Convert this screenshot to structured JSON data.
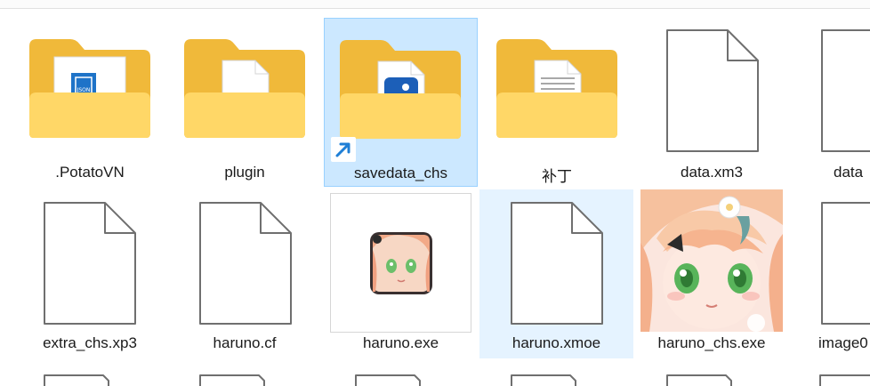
{
  "items": [
    {
      "label": ".PotatoVN",
      "icon": "folder-json-icon"
    },
    {
      "label": "plugin",
      "icon": "folder-file-icon"
    },
    {
      "label": "savedata_chs",
      "icon": "folder-shortcut-icon",
      "selected": true
    },
    {
      "label": "补丁",
      "icon": "folder-doc-icon"
    },
    {
      "label": "data.xm3",
      "icon": "blank-file-icon"
    },
    {
      "label": "data",
      "icon": "blank-file-icon"
    },
    {
      "label": "extra_chs.xp3",
      "icon": "blank-file-icon"
    },
    {
      "label": "haruno.cf",
      "icon": "blank-file-icon"
    },
    {
      "label": "haruno.exe",
      "icon": "exe-thumbnail-icon"
    },
    {
      "label": "haruno.xmoe",
      "icon": "blank-file-icon",
      "hovered": true
    },
    {
      "label": "haruno_chs.exe",
      "icon": "anime-thumbnail-icon"
    },
    {
      "label": "image0",
      "icon": "blank-file-icon"
    }
  ],
  "colors": {
    "folder_back": "#f0b93a",
    "folder_front": "#ffd767",
    "selection_bg": "#cce8ff",
    "hover_bg": "#e5f3ff",
    "shortcut_arrow": "#1f7fd6"
  }
}
